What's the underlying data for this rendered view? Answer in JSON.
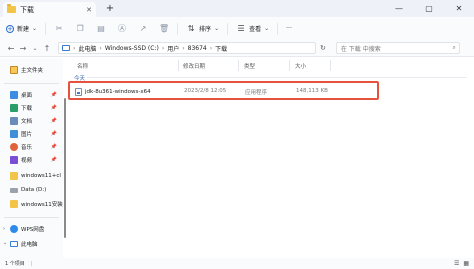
{
  "window": {
    "tab_title": "下载",
    "tab_close": "✕",
    "new_tab": "+",
    "minimize": "—",
    "maximize": "▢",
    "close": "✕"
  },
  "toolbar": {
    "new_label": "新建",
    "sort_label": "排序",
    "view_label": "查看",
    "more": "···",
    "icons": [
      "cut-icon",
      "copy-icon",
      "paste-icon",
      "rename-icon",
      "share-icon",
      "delete-icon"
    ]
  },
  "address": {
    "segments": [
      "此电脑",
      "Windows-SSD (C:)",
      "用户",
      "83674",
      "下载"
    ],
    "search_placeholder": "在 下载 中搜索"
  },
  "sidebar": {
    "home": "主文件夹",
    "quick": [
      {
        "label": "桌面",
        "icon": "desktop-icon",
        "color": "#3d8ee0"
      },
      {
        "label": "下载",
        "icon": "download-icon",
        "color": "#2a9d6a"
      },
      {
        "label": "文档",
        "icon": "documents-icon",
        "color": "#6b8bb8"
      },
      {
        "label": "图片",
        "icon": "pictures-icon",
        "color": "#3f8fd8"
      },
      {
        "label": "音乐",
        "icon": "music-icon",
        "color": "#e0623b"
      },
      {
        "label": "视频",
        "icon": "videos-icon",
        "color": "#7a4fd6"
      }
    ],
    "folders": [
      "windows11+cl",
      "Data (D:)",
      "windows11安装"
    ],
    "wps": "WPS网盘",
    "this_pc": "此电脑"
  },
  "columns": {
    "name": "名称",
    "date": "修改日期",
    "type": "类型",
    "size": "大小"
  },
  "group_label": "今天",
  "files": [
    {
      "name": "jdk-8u361-windows-x64",
      "date": "2023/2/8 12:05",
      "type": "应用程序",
      "size": "148,113 KB"
    }
  ],
  "status": {
    "count": "1 个项目",
    "selected": "|"
  },
  "colors": {
    "highlight": "#e5533d",
    "accent": "#2a6bd4"
  }
}
